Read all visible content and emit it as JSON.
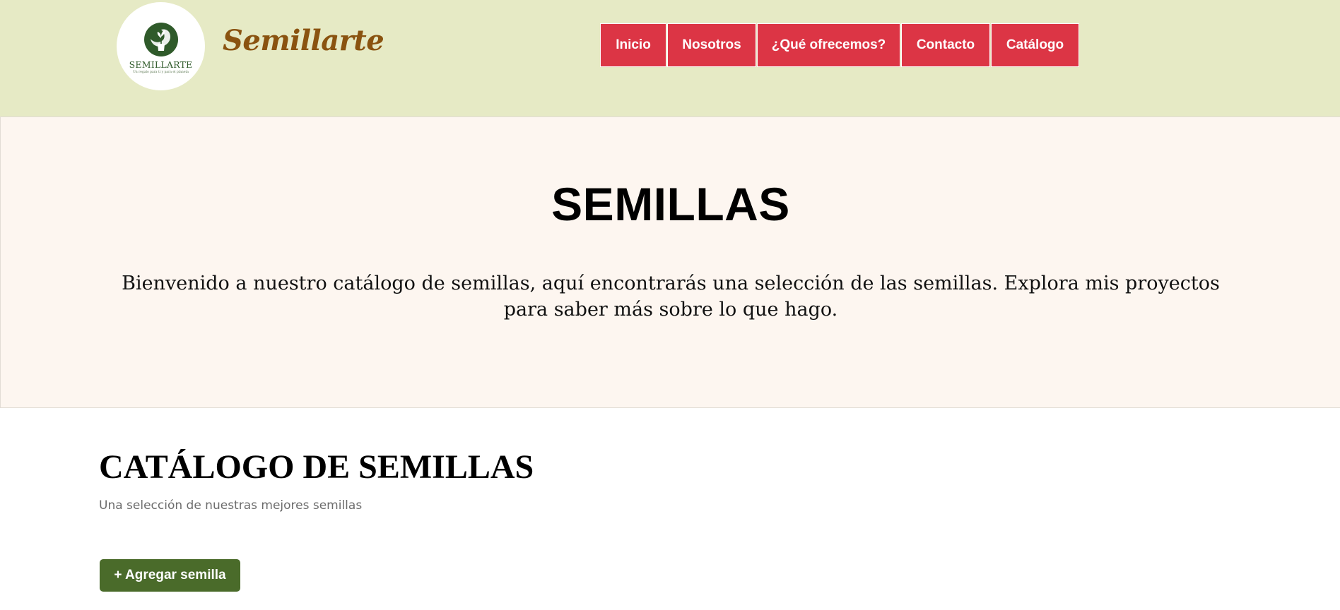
{
  "header": {
    "logo": {
      "text": "SEMILLARTE",
      "tagline": "Un regalo para ti y para el planeta"
    },
    "brand": "Semillarte",
    "nav": [
      "Inicio",
      "Nosotros",
      "¿Qué ofrecemos?",
      "Contacto",
      "Catálogo"
    ]
  },
  "hero": {
    "title": "SEMILLAS",
    "text": "Bienvenido a nuestro catálogo de semillas, aquí encontrarás una selección de las semillas. Explora mis proyectos para saber más sobre lo que hago."
  },
  "catalog": {
    "title": "CATÁLOGO DE SEMILLAS",
    "subtitle": "Una selección de nuestras mejores semillas",
    "add_button": "+ Agregar semilla"
  },
  "colors": {
    "header_bg": "#e6eac5",
    "nav_bg": "#dc3545",
    "brand_text": "#8a5310",
    "hero_bg": "#fdf6f0",
    "button_bg": "#4a6b2a"
  },
  "icons": {
    "logo": "plant-pot-icon"
  }
}
